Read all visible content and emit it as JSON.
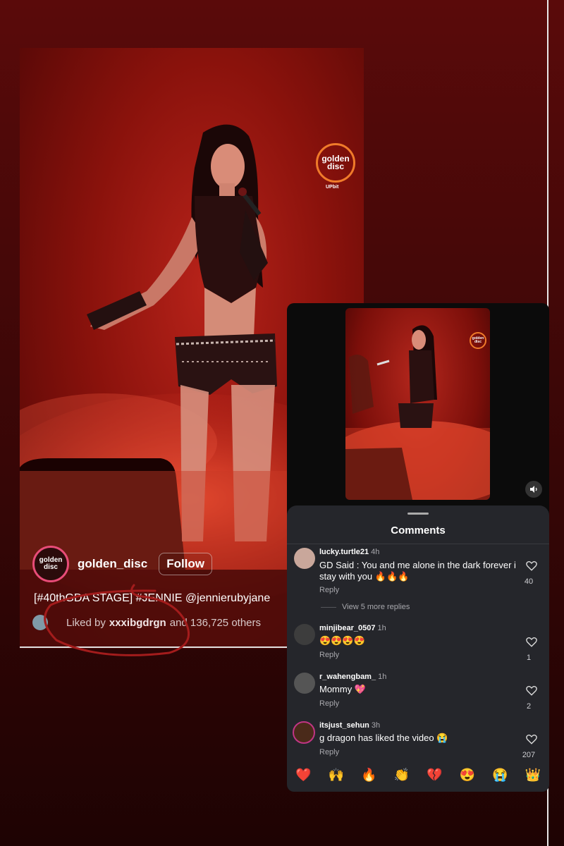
{
  "post": {
    "account_name": "golden_disc",
    "follow_label": "Follow",
    "caption": "[#40thGDA STAGE] #JENNIE @jennierubyjane",
    "liked_prefix": "Liked by",
    "liked_user": "xxxibgdrgn",
    "liked_suffix": "and 136,725 others",
    "logo_line1": "golden",
    "logo_line2": "disc",
    "logo_sub": "UPbit"
  },
  "comments_sheet": {
    "title": "Comments",
    "items": [
      {
        "user": "lucky.turtle21",
        "time": "4h",
        "text": "GD Said : You and me alone in the dark forever i stay with you 🔥🔥🔥",
        "reply": "Reply",
        "likes": "40",
        "more_replies": "View 5 more replies"
      },
      {
        "user": "minjibear_0507",
        "time": "1h",
        "text": "😍😍😍😍",
        "reply": "Reply",
        "likes": "1"
      },
      {
        "user": "r_wahengbam_",
        "time": "1h",
        "text": "Mommy 💖",
        "reply": "Reply",
        "likes": "2"
      },
      {
        "user": "itsjust_sehun",
        "time": "3h",
        "text": "g dragon has liked the video 😭",
        "reply": "Reply",
        "likes": "207"
      }
    ],
    "emoji_bar": [
      "❤️",
      "🙌",
      "🔥",
      "👏",
      "💔",
      "😍",
      "😭",
      "👑"
    ]
  },
  "colors": {
    "background": "#3d0707",
    "annotation_circle": "#a31c1c",
    "sheet": "#25262b",
    "avatar_ring": "#e84c78"
  },
  "icons": [
    "heart-icon",
    "volume-icon",
    "golden-disc-logo"
  ]
}
